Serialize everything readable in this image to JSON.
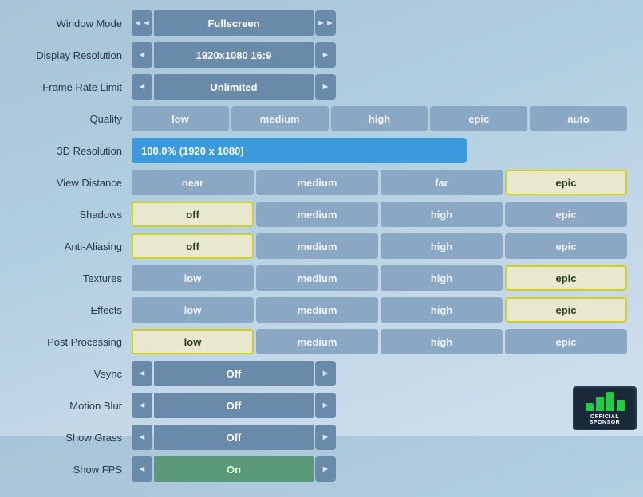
{
  "labels": {
    "window_mode": "Window Mode",
    "display_resolution": "Display Resolution",
    "frame_rate_limit": "Frame Rate Limit",
    "quality": "Quality",
    "resolution_3d": "3D Resolution",
    "view_distance": "View Distance",
    "shadows": "Shadows",
    "anti_aliasing": "Anti-Aliasing",
    "textures": "Textures",
    "effects": "Effects",
    "post_processing": "Post Processing",
    "vsync": "Vsync",
    "motion_blur": "Motion Blur",
    "show_grass": "Show Grass",
    "show_fps": "Show FPS"
  },
  "values": {
    "window_mode": "Fullscreen",
    "display_resolution": "1920x1080 16:9",
    "frame_rate_limit": "Unlimited",
    "resolution_3d": "100.0% (1920 x 1080)",
    "vsync": "Off",
    "motion_blur": "Off",
    "show_grass": "Off",
    "show_fps": "On"
  },
  "quality_tabs": [
    "low",
    "medium",
    "high",
    "epic",
    "auto"
  ],
  "view_distance_tabs": [
    "near",
    "medium",
    "far",
    "epic"
  ],
  "shadows_tabs": [
    "off",
    "medium",
    "high",
    "epic"
  ],
  "anti_aliasing_tabs": [
    "off",
    "medium",
    "high",
    "epic"
  ],
  "textures_tabs": [
    "low",
    "medium",
    "high",
    "epic"
  ],
  "effects_tabs": [
    "low",
    "medium",
    "high",
    "epic"
  ],
  "post_processing_tabs": [
    "low",
    "medium",
    "high",
    "epic"
  ],
  "selected": {
    "view_distance": "epic",
    "shadows": "epic",
    "anti_aliasing": "off",
    "textures": "epic",
    "effects": "epic",
    "post_processing": "low"
  },
  "sponsor": {
    "label": "OFFICIAL SPONSOR"
  }
}
